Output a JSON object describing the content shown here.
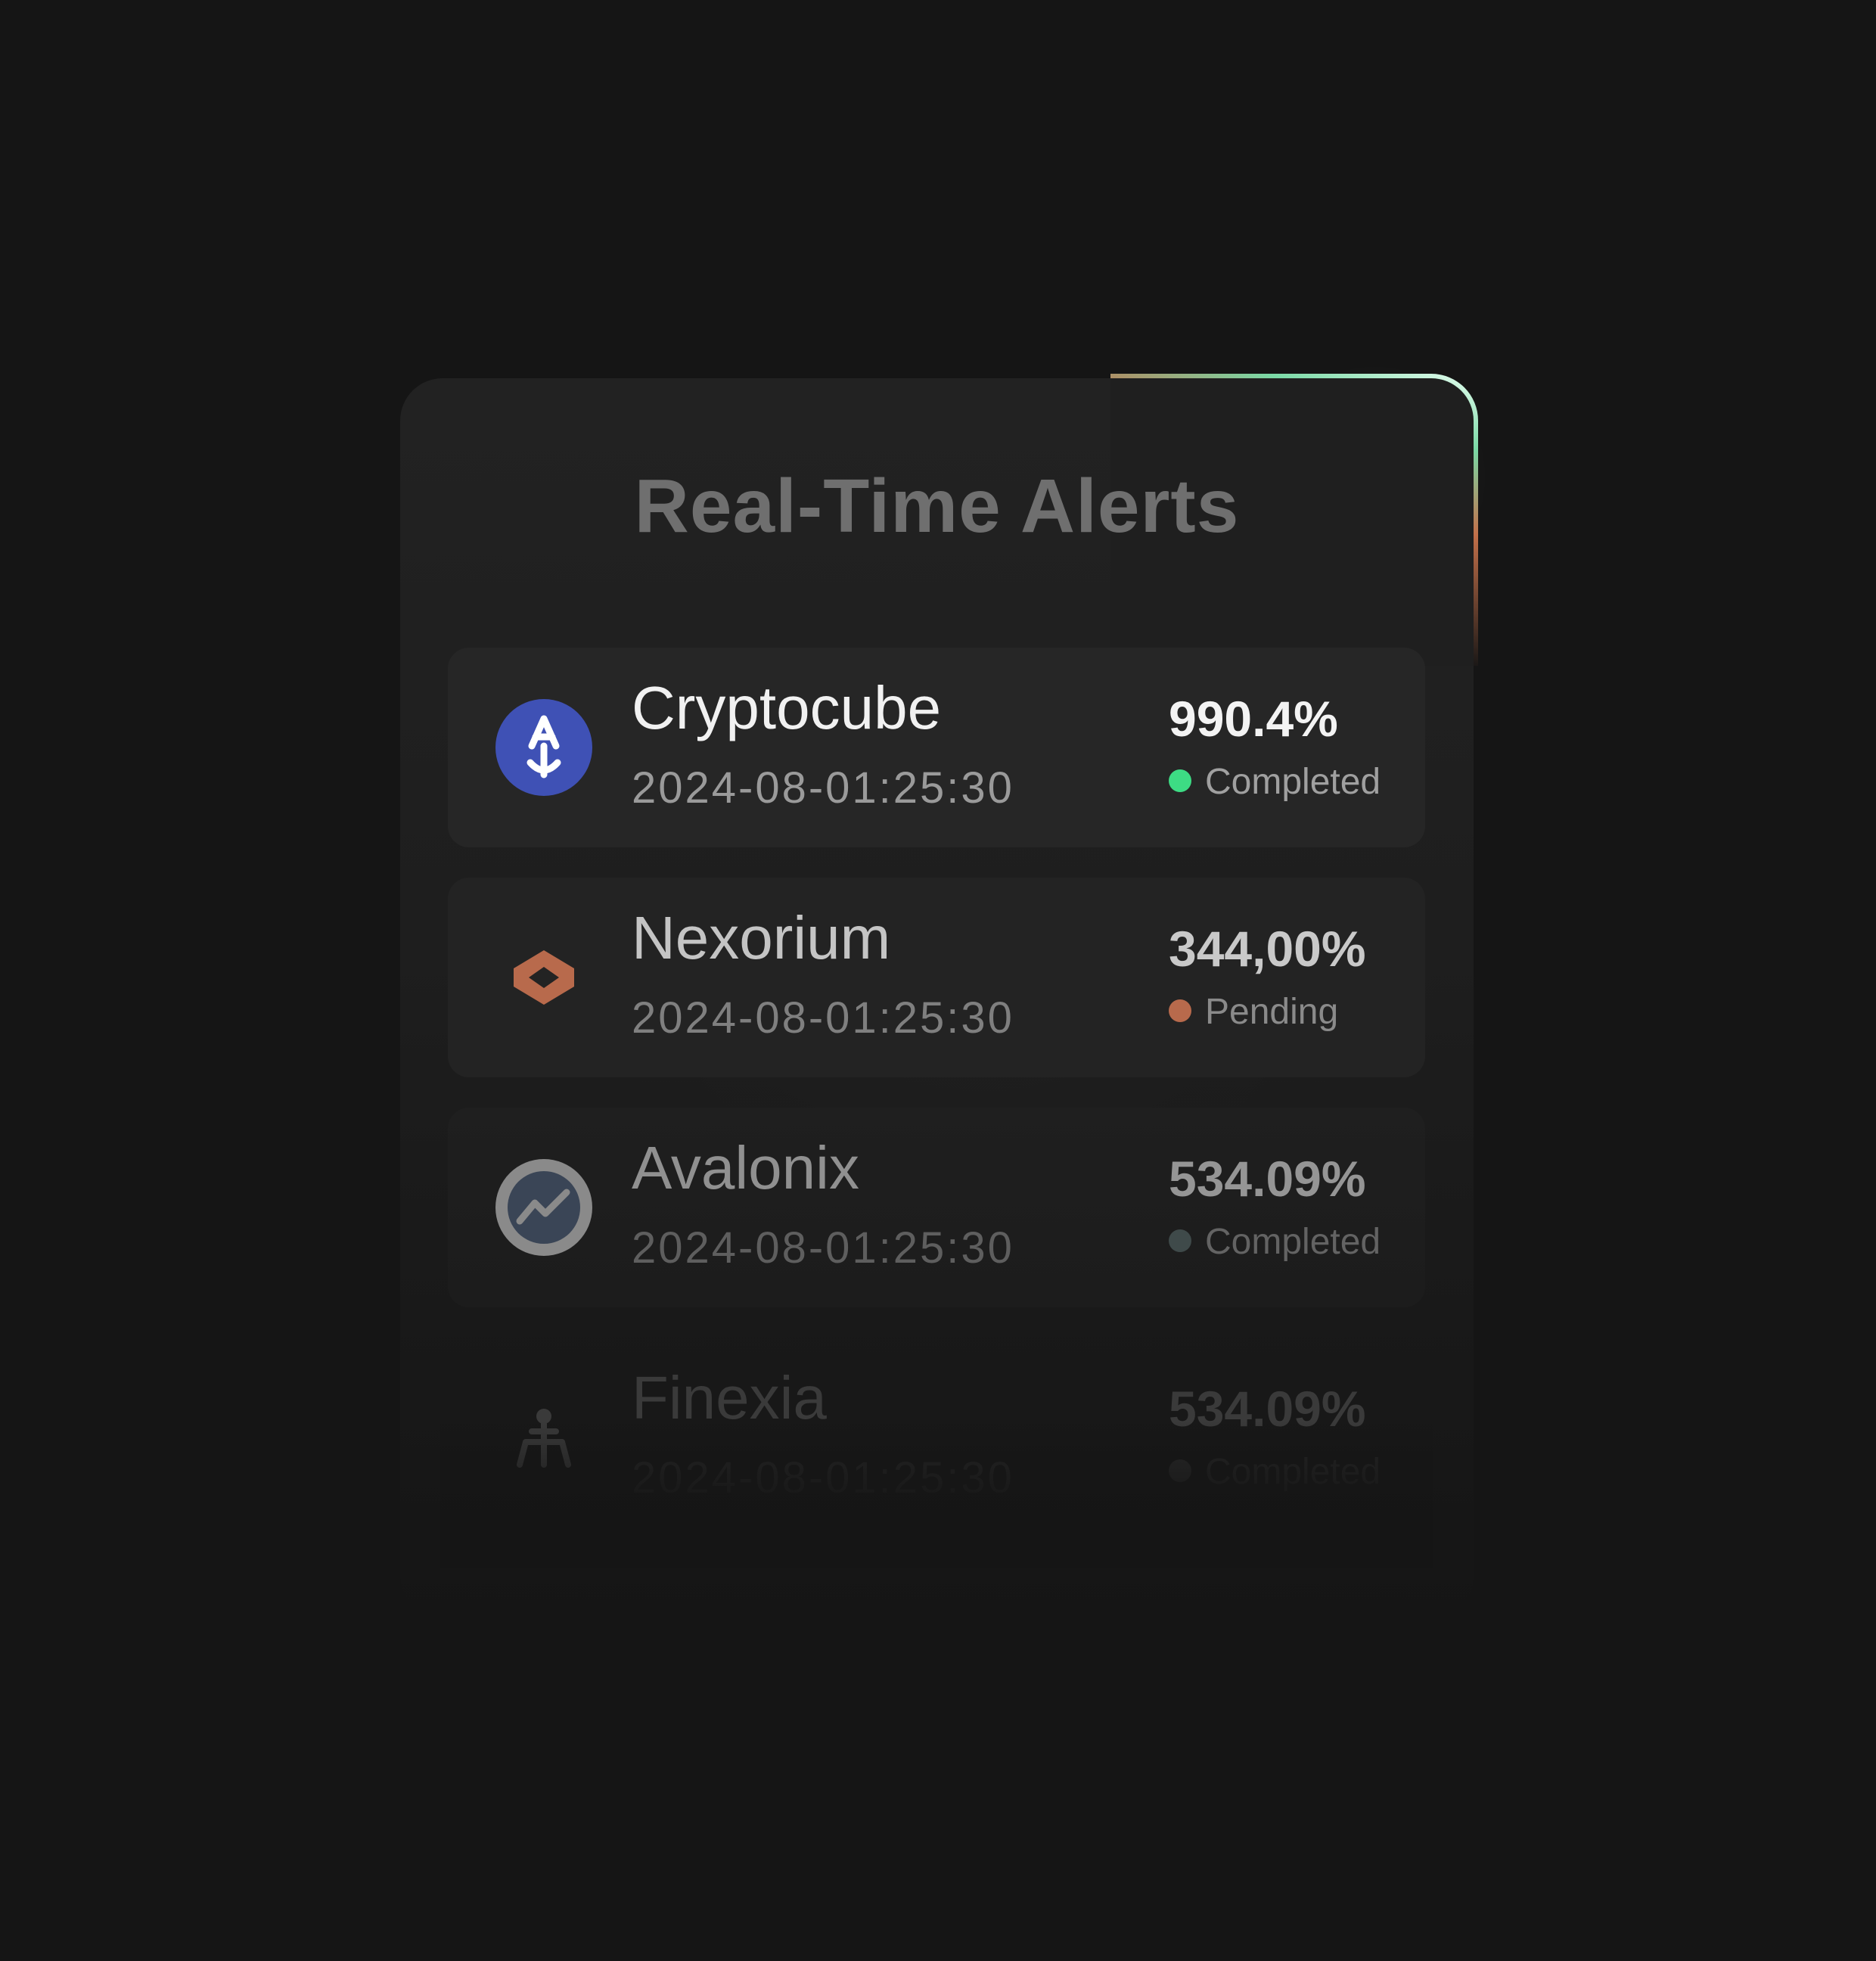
{
  "panel": {
    "title": "Real-Time Alerts"
  },
  "alerts": [
    {
      "name": "Cryptocube",
      "timestamp": "2024-08-01:25:30",
      "percent": "990.4%",
      "status": "Completed",
      "status_color": "#3ddc84",
      "icon": "cryptocube-anchor-icon",
      "icon_color": "#3f51b5"
    },
    {
      "name": "Nexorium",
      "timestamp": "2024-08-01:25:30",
      "percent": "344,00%",
      "status": "Pending",
      "status_color": "#b86a4c",
      "icon": "nexorium-hexagon-icon",
      "icon_color": "#b86a4c"
    },
    {
      "name": "Avalonix",
      "timestamp": "2024-08-01:25:30",
      "percent": "534.09%",
      "status": "Completed",
      "status_color": "#3f4a4a",
      "icon": "avalonix-trend-icon",
      "icon_color": "#8a8a8a"
    },
    {
      "name": "Finexia",
      "timestamp": "2024-08-01:25:30",
      "percent": "534.09%",
      "status": "Completed",
      "status_color": "#2a2a2a",
      "icon": "finexia-tree-icon",
      "icon_color": "#3a3a3a"
    }
  ],
  "colors": {
    "background": "#151515",
    "panel": "#222222",
    "row": "#262626",
    "accent_green": "#3ddc84",
    "accent_copper": "#b86a4c"
  }
}
